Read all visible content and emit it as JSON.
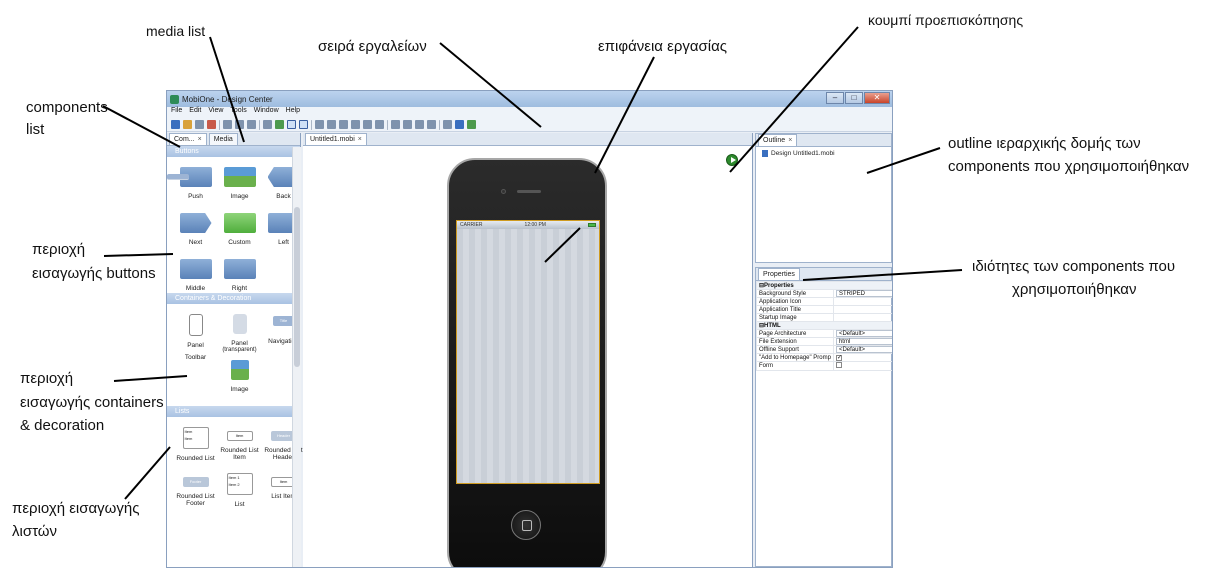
{
  "annotations": {
    "media_list": "media list",
    "toolbar": "σειρά εργαλείων",
    "workspace": "επιφάνεια εργασίας",
    "preview_button": "κουμπί προεπισκόπησης",
    "components_list_1": "components",
    "components_list_2": "list",
    "outline_1": "outline ιεραρχικής δομής των",
    "outline_2": "components που χρησιμοποιήθηκαν",
    "buttons_area_1": "περιοχή",
    "buttons_area_2": "εισαγωγής buttons",
    "properties_1": "ιδιότητες των components που",
    "properties_2": "χρησιμοποιήθηκαν",
    "containers_area_1": "περιοχή",
    "containers_area_2": "εισαγωγής containers",
    "containers_area_3": "& decoration",
    "lists_area_1": "περιοχή εισαγωγής",
    "lists_area_2": "λιστών"
  },
  "window": {
    "title": "MobiOne - Design Center",
    "menu": [
      "File",
      "Edit",
      "View",
      "Tools",
      "Window",
      "Help"
    ]
  },
  "left_panel": {
    "tabs": [
      {
        "label": "Com..."
      },
      {
        "label": "Media"
      }
    ],
    "sections": {
      "buttons": {
        "title": "Buttons",
        "items": [
          "Push",
          "Image",
          "Back",
          "Next",
          "Custom",
          "Left",
          "Middle",
          "Right"
        ]
      },
      "containers": {
        "title": "Containers & Decoration",
        "items": [
          "Panel",
          "Panel",
          "Navigation",
          "Toolbar",
          "Image"
        ],
        "panel_sub": "(transparent)",
        "nav_icon_text": "Title"
      },
      "lists": {
        "title": "Lists",
        "items": [
          "Rounded List",
          "Rounded List Item",
          "Rounded List Header",
          "Rounded List Footer",
          "List",
          "List Item"
        ],
        "icon_text": {
          "item": "Item",
          "header": "Header",
          "footer": "Footer",
          "item1": "Item 1",
          "item2": "Item 2"
        }
      }
    }
  },
  "editor": {
    "tab_label": "Untitled1.mobi",
    "status_carrier": "CARRIER",
    "status_time": "12:00 PM"
  },
  "outline": {
    "tab_label": "Outline",
    "item": "Design Untitled1.mobi"
  },
  "properties": {
    "tab_label": "Properties",
    "group1": "Properties",
    "group2": "HTML",
    "rows": {
      "background_style": {
        "name": "Background Style",
        "value": "STRIPED"
      },
      "app_icon": {
        "name": "Application Icon"
      },
      "app_title": {
        "name": "Application Title"
      },
      "startup_image": {
        "name": "Startup Image"
      },
      "page_arch": {
        "name": "Page Architecture",
        "value": "<Default>"
      },
      "file_ext": {
        "name": "File Extension",
        "value": "html"
      },
      "offline": {
        "name": "Offline Support",
        "value": "<Default>"
      },
      "add_home": {
        "name": "\"Add to Homepage\" Promp",
        "value": "✓"
      },
      "form": {
        "name": "Form"
      }
    }
  },
  "colors": {
    "accent": "#3a6fbf",
    "section_header": "#a9c2e3",
    "preview_green": "#2d8a2d",
    "screen_border": "#cf9b20"
  }
}
